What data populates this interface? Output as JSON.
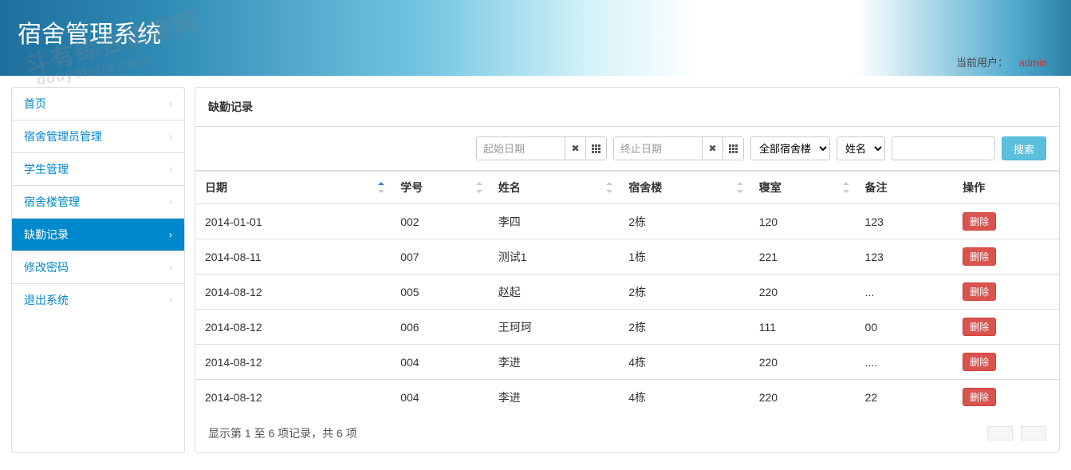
{
  "header": {
    "title": "宿舍管理系统",
    "current_user_label": "当前用户：",
    "username": "admin"
  },
  "sidebar": {
    "items": [
      {
        "label": "首页",
        "active": false
      },
      {
        "label": "宿舍管理员管理",
        "active": false
      },
      {
        "label": "学生管理",
        "active": false
      },
      {
        "label": "宿舍楼管理",
        "active": false
      },
      {
        "label": "缺勤记录",
        "active": true
      },
      {
        "label": "修改密码",
        "active": false
      },
      {
        "label": "退出系统",
        "active": false
      }
    ]
  },
  "main": {
    "panel_title": "缺勤记录",
    "filters": {
      "start_date_placeholder": "起始日期",
      "end_date_placeholder": "终止日期",
      "building_select": "全部宿舍楼",
      "name_select": "姓名",
      "search_button": "搜索"
    },
    "table": {
      "columns": [
        "日期",
        "学号",
        "姓名",
        "宿舍楼",
        "寝室",
        "备注",
        "操作"
      ],
      "rows": [
        {
          "date": "2014-01-01",
          "sid": "002",
          "name": "李四",
          "building": "2栋",
          "room": "120",
          "note": "123"
        },
        {
          "date": "2014-08-11",
          "sid": "007",
          "name": "测试1",
          "building": "1栋",
          "room": "221",
          "note": "123"
        },
        {
          "date": "2014-08-12",
          "sid": "005",
          "name": "赵起",
          "building": "2栋",
          "room": "220",
          "note": "..."
        },
        {
          "date": "2014-08-12",
          "sid": "006",
          "name": "王珂珂",
          "building": "2栋",
          "room": "111",
          "note": "00"
        },
        {
          "date": "2014-08-12",
          "sid": "004",
          "name": "李进",
          "building": "4栋",
          "room": "220",
          "note": "...."
        },
        {
          "date": "2014-08-12",
          "sid": "004",
          "name": "李进",
          "building": "4栋",
          "room": "220",
          "note": "22"
        }
      ],
      "delete_label": "删除"
    },
    "footer": "显示第 1 至 6 项记录，共 6 项"
  }
}
